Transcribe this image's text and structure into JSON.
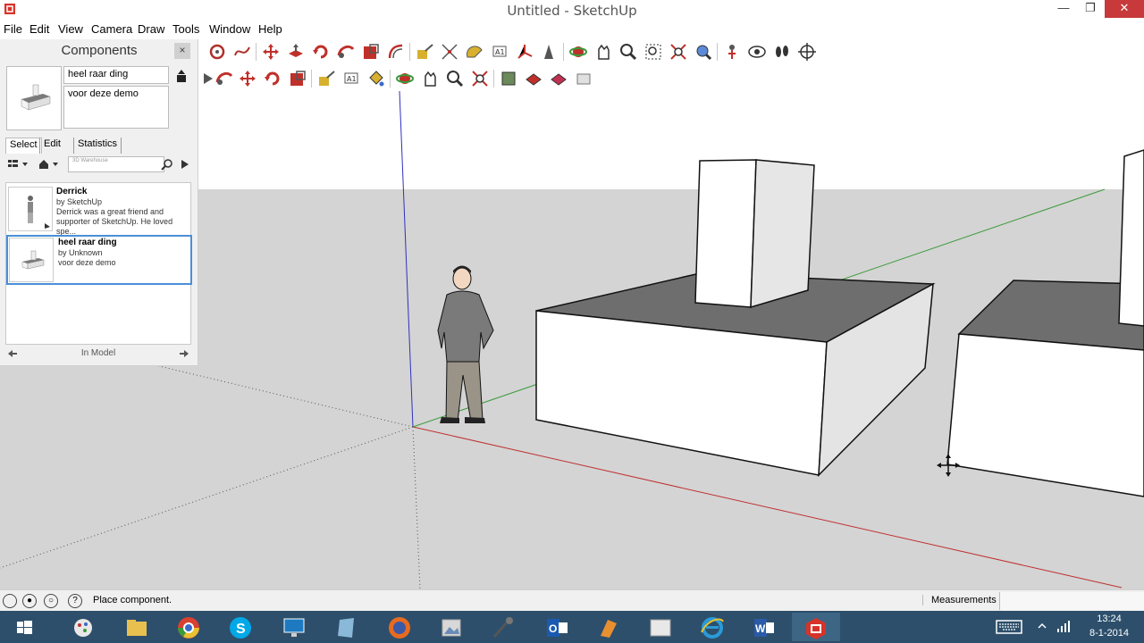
{
  "window": {
    "title": "Untitled - SketchUp"
  },
  "menu": [
    "File",
    "Edit",
    "View",
    "Camera",
    "Draw",
    "Tools",
    "Window",
    "Help"
  ],
  "components_panel": {
    "title": "Components",
    "close_label": "×",
    "name_value": "heel raar ding",
    "description_value": "voor deze demo",
    "tabs": [
      "Select",
      "Edit",
      "Statistics"
    ],
    "search_placeholder": "3D Warehouse",
    "items": [
      {
        "name": "Derrick",
        "by": "by SketchUp",
        "description": "Derrick was a great friend and supporter of SketchUp. He loved spe..."
      },
      {
        "name": "heel raar ding",
        "by": "by Unknown",
        "description": "voor deze demo"
      }
    ],
    "collection_label": "In Model"
  },
  "status": {
    "text": "Place component.",
    "measurements_label": "Measurements",
    "measurements_value": ""
  },
  "taskbar": {
    "time": "13:24",
    "date": "8-1-2014"
  },
  "colors": {
    "sky": "#ffffff",
    "ground": "#d4d4d4",
    "axis_red": "#c03030",
    "axis_green": "#3a9a3a",
    "axis_blue": "#3030c0",
    "taskbar": "#2d4f6b",
    "close": "#c7393a",
    "selection": "#4a8fd8"
  }
}
